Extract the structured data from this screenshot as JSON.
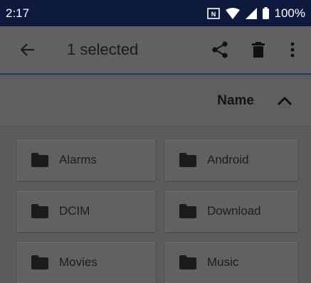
{
  "status_bar": {
    "time": "2:17",
    "battery": "100%",
    "icons": [
      "nfc-icon",
      "wifi-icon",
      "signal-icon",
      "battery-icon"
    ]
  },
  "app_bar": {
    "title": "1 selected",
    "icons": [
      "back-arrow-icon",
      "share-icon",
      "delete-icon",
      "more-vert-icon"
    ]
  },
  "sort": {
    "label": "Name",
    "direction_icon": "chevron-up-icon"
  },
  "folders": [
    {
      "name": "Alarms"
    },
    {
      "name": "Android"
    },
    {
      "name": "DCIM"
    },
    {
      "name": "Download"
    },
    {
      "name": "Movies"
    },
    {
      "name": "Music"
    }
  ],
  "colors": {
    "status_bar_bg": "#0d1a3e",
    "scrim_bg": "#5b5b5b",
    "accent_line": "#1f3f74"
  }
}
